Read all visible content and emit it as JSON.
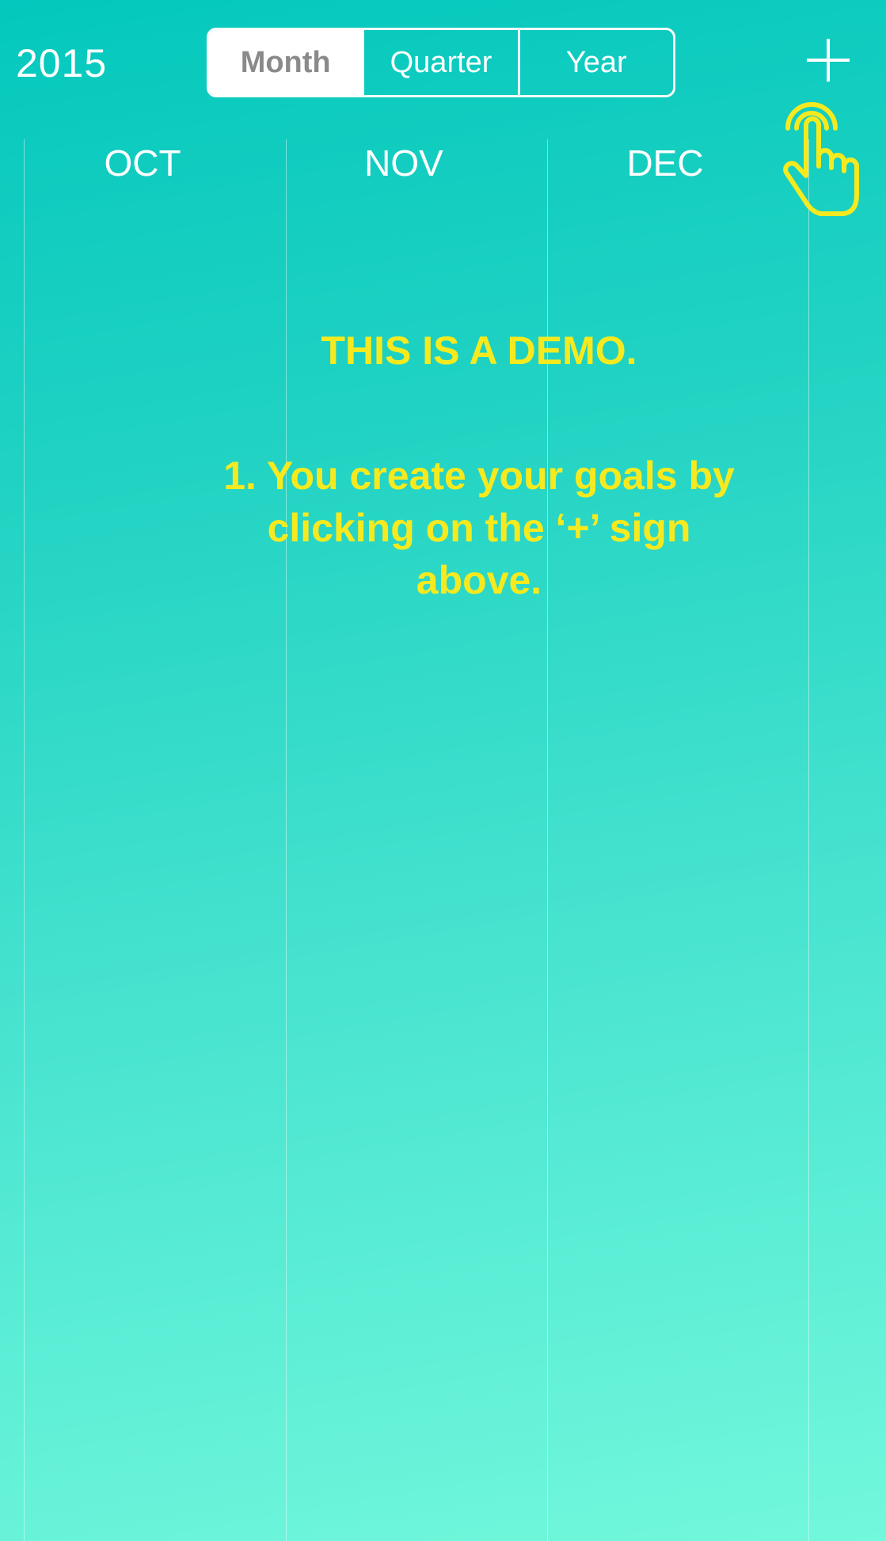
{
  "header": {
    "year": "2015",
    "segments": [
      {
        "label": "Month",
        "active": true
      },
      {
        "label": "Quarter",
        "active": false
      },
      {
        "label": "Year",
        "active": false
      }
    ],
    "add_icon": "plus-icon",
    "hint_icon": "tap-hand-icon"
  },
  "months": [
    "OCT",
    "NOV",
    "DEC"
  ],
  "demo": {
    "title": "THIS IS A DEMO.",
    "instruction": "1. You create your goals by clicking on the ‘+’ sign above."
  },
  "colors": {
    "accent_yellow": "#f6ea1f",
    "background_top": "#04c8bd",
    "background_bottom": "#72f8dc",
    "segment_active_text": "#8a8a8a"
  }
}
